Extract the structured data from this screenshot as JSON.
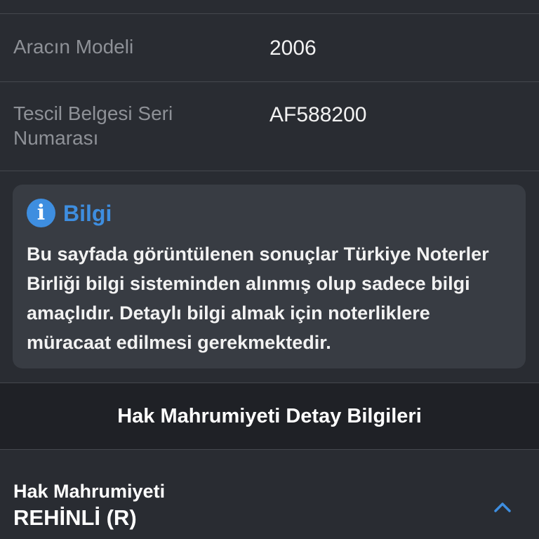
{
  "vehicle_rows": [
    {
      "label": "Aracın Modeli",
      "value": "2006"
    },
    {
      "label": "Tescil Belgesi Seri Numarası",
      "value": "AF588200"
    }
  ],
  "info_card": {
    "icon": "info-icon",
    "icon_glyph": "i",
    "title": "Bilgi",
    "text": "Bu sayfada görüntülenen sonuçlar Türkiye Noterler Birliği bilgi sisteminden alınmış olup sadece bilgi amaçlıdır. Detaylı bilgi almak için noterliklere müracaat edilmesi gerekmektedir."
  },
  "section": {
    "title": "Hak Mahrumiyeti Detay Bilgileri"
  },
  "detail": {
    "label": "Hak Mahrumiyeti",
    "value": "REHİNLİ (R)",
    "toggle_icon": "chevron-up-icon"
  },
  "colors": {
    "background": "#292c32",
    "card": "#383c43",
    "accent": "#3e8ee0",
    "header_band": "#1f2126"
  }
}
